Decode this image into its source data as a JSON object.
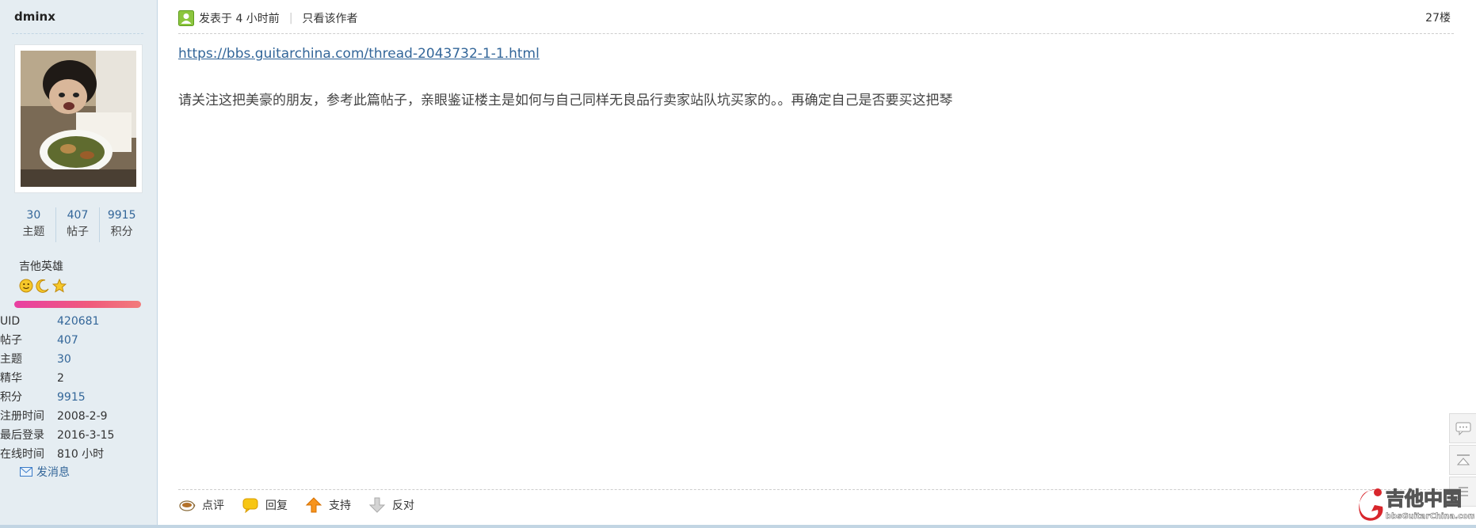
{
  "user": {
    "username": "dminx",
    "stats": [
      {
        "value": "30",
        "label": "主题"
      },
      {
        "value": "407",
        "label": "帖子"
      },
      {
        "value": "9915",
        "label": "积分"
      }
    ],
    "rank_title": "吉他英雄",
    "rank_icons": [
      "smiley-icon",
      "moon-icon",
      "star-icon"
    ],
    "profile": [
      {
        "key": "UID",
        "value": "420681",
        "link": true
      },
      {
        "key": "帖子",
        "value": "407",
        "link": true
      },
      {
        "key": "主题",
        "value": "30",
        "link": true
      },
      {
        "key": "精华",
        "value": "2",
        "link": false
      },
      {
        "key": "积分",
        "value": "9915",
        "link": true
      },
      {
        "key": "注册时间",
        "value": "2008-2-9",
        "link": false
      },
      {
        "key": "最后登录",
        "value": "2016-3-15",
        "link": false
      },
      {
        "key": "在线时间",
        "value": "810 小时",
        "link": false
      }
    ],
    "send_message": "发消息"
  },
  "post": {
    "posted_at": "发表于 4 小时前",
    "separator": "|",
    "only_author": "只看该作者",
    "floor": "27楼",
    "link": "https://bbs.guitarchina.com/thread-2043732-1-1.html",
    "body": "请关注这把美豪的朋友，参考此篇帖子，亲眼鉴证楼主是如何与自己同样无良品行卖家站队坑买家的。。再确定自己是否要买这把琴",
    "actions": {
      "comment": "点评",
      "reply": "回复",
      "support": "支持",
      "oppose": "反对"
    }
  },
  "watermark": {
    "cn": "吉他中国",
    "en": "bbsGuitarChina.com"
  },
  "colors": {
    "sidebar_bg": "#e5edf2",
    "link": "#336699",
    "rank_bar": "#ea4a93"
  }
}
